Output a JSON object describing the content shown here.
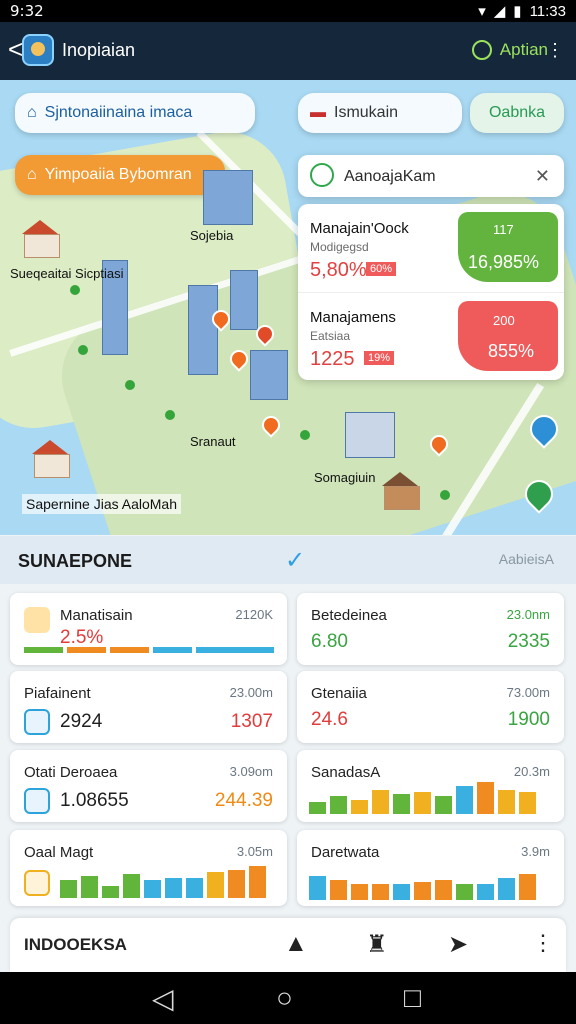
{
  "status": {
    "time": "9:32",
    "right_time": "11:33"
  },
  "appbar": {
    "title": "Inopiaian",
    "action": "Aptian",
    "more": "⋮",
    "back": "<"
  },
  "map": {
    "top_pill": "Sjntonaiinaina imaca",
    "orange_pill": "Yimpoaiia Bybomran",
    "search_placeholder": "Ismukain",
    "search_button": "Oabnka",
    "header_panel": {
      "title": "AanoajaKam",
      "icon": "✕"
    },
    "panel_items": [
      {
        "title": "Manajain'Oock",
        "subtitle": "Modigegsd",
        "value": "5,80%",
        "badge": "60%",
        "metric_top": "117",
        "metric_bottom": "16,985%",
        "accent": "#63b43e"
      },
      {
        "title": "Manajamens",
        "subtitle": "Eatsiaa",
        "value": "1225",
        "badge": "19%",
        "metric_top": "200",
        "metric_bottom": "855%",
        "accent": "#ef5b5b"
      }
    ],
    "labels": [
      "Sojebia",
      "Sueqeaitai Sicptiasi",
      "Sranaut",
      "Somagiuin",
      "Sapernine Jias AaloMah"
    ]
  },
  "section": {
    "title": "SUNAEPONE",
    "check": "✓",
    "right": "AabieisA"
  },
  "cards": [
    {
      "title": "Manatisain",
      "side": "2120K",
      "value": "2.5%",
      "style": "red",
      "chart": [
        22,
        22,
        22,
        22,
        22
      ]
    },
    {
      "title": "Betedeinea",
      "side": "23.0nm",
      "value": "6.80",
      "value2": "2335",
      "style": "green"
    },
    {
      "title": "Piafainent",
      "side": "23.00m",
      "value": "2924",
      "value2": "1307",
      "style": "red"
    },
    {
      "title": "Gtenaiia",
      "side": "73.00m",
      "value": "24.6",
      "value2": "1900",
      "style": "green"
    },
    {
      "title": "Otati Deroaea",
      "side": "3.09om",
      "value": "1.08655",
      "value2": "244.39",
      "style": "orange"
    },
    {
      "title": "SanadasA",
      "side": "20.3m",
      "value": "",
      "style": "bars"
    },
    {
      "title": "Oaal Magt",
      "side": "3.05m",
      "value": "",
      "style": "bars"
    },
    {
      "title": "Daretwata",
      "side": "3.9m",
      "value": "",
      "style": "bars"
    }
  ],
  "bottom": {
    "title": "INDOOEKSA"
  },
  "nav": {
    "back": "◁",
    "home": "○",
    "recent": "□"
  }
}
